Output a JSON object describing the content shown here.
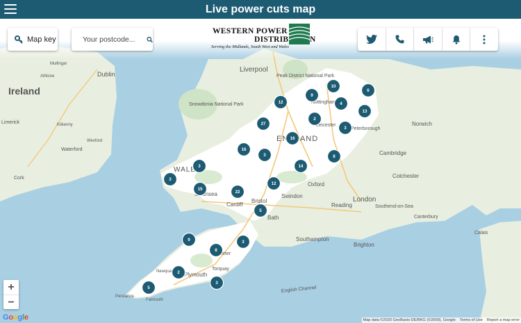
{
  "header": {
    "title": "Live power cuts map",
    "menu_icon": "hamburger-icon"
  },
  "controls": {
    "map_key_label": "Map key",
    "map_key_icon": "key-icon",
    "postcode_placeholder": "Your postcode...",
    "search_icon": "search-icon",
    "right_icons": [
      "twitter-icon",
      "phone-icon",
      "megaphone-icon",
      "bell-icon",
      "more-vert-icon"
    ]
  },
  "logo": {
    "line1": "WESTERN POWER",
    "line2": "DISTRIBUTION",
    "tagline": "Serving the Midlands, South West and Wales"
  },
  "colors": {
    "brand": "#1d5b73",
    "land": "#e8efe0",
    "sea": "#a9cfe3",
    "served": "#ffffff"
  },
  "map_labels": {
    "ireland": "Ireland",
    "dublin": "Dublin",
    "mullingar": "Mullingar",
    "athlone": "Athlone",
    "limerick": "Limerick",
    "kilkenny": "Kilkenny",
    "waterford": "Waterford",
    "wexford": "Wexford",
    "cork": "Cork",
    "liverpool": "Liverpool",
    "snowdonia": "Snowdonia National Park",
    "peak_district": "Peak District National Park",
    "nottingham": "Nottingham",
    "leicester": "Leicester",
    "peterborough": "Peterborough",
    "norwich": "Norwich",
    "cambridge": "Cambridge",
    "colchester": "Colchester",
    "england": "ENGLAND",
    "wales": "WALES",
    "oxford": "Oxford",
    "swindon": "Swindon",
    "cardiff": "Cardiff",
    "swansea": "Swansea",
    "bristol": "Bristol",
    "bath": "Bath",
    "reading": "Reading",
    "london": "London",
    "southend": "Southend-on-Sea",
    "canterbury": "Canterbury",
    "southampton": "Southampton",
    "brighton": "Brighton",
    "exeter": "Exeter",
    "torquay": "Torquay",
    "plymouth": "Plymouth",
    "newquay": "Newquay",
    "falmouth": "Falmouth",
    "penzance": "Penzance",
    "english_channel": "English Channel",
    "calais": "Calais"
  },
  "markers": [
    {
      "label": "6"
    },
    {
      "label": "10"
    },
    {
      "label": "9"
    },
    {
      "label": "12"
    },
    {
      "label": "4"
    },
    {
      "label": "13"
    },
    {
      "label": "2"
    },
    {
      "label": "3"
    },
    {
      "label": "27"
    },
    {
      "label": "16"
    },
    {
      "label": "16"
    },
    {
      "label": "3"
    },
    {
      "label": "8"
    },
    {
      "label": "14"
    },
    {
      "label": "3"
    },
    {
      "label": "3"
    },
    {
      "label": "12"
    },
    {
      "label": "15"
    },
    {
      "label": "22"
    },
    {
      "label": "5"
    },
    {
      "label": "9"
    },
    {
      "label": "8"
    },
    {
      "label": "3"
    },
    {
      "label": "2"
    },
    {
      "label": "3"
    },
    {
      "label": "5"
    }
  ],
  "zoom": {
    "plus": "+",
    "minus": "−"
  },
  "google_logo": "Google",
  "attribution": {
    "data": "Map data ©2020 GeoBasis-DE/BKG (©2009), Google",
    "terms": "Terms of Use",
    "report": "Report a map error"
  }
}
